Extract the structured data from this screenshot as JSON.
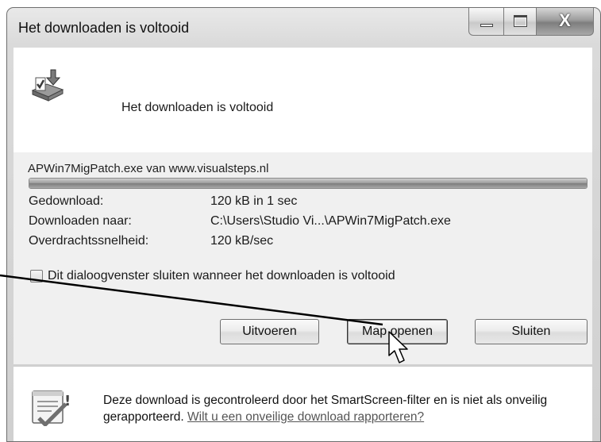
{
  "window": {
    "title": "Het downloaden is voltooid",
    "close_glyph": "X"
  },
  "header": {
    "title": "Het downloaden is voltooid"
  },
  "download": {
    "file_line": "APWin7MigPatch.exe van www.visualsteps.nl",
    "progress": 1.0,
    "rows": [
      {
        "label": "Gedownload:",
        "value": "120 kB in 1 sec"
      },
      {
        "label": "Downloaden naar:",
        "value": "C:\\Users\\Studio Vi...\\APWin7MigPatch.exe"
      },
      {
        "label": "Overdrachtssnelheid:",
        "value": "120 kB/sec"
      }
    ]
  },
  "options": {
    "close_checkbox_label": "Dit dialoogvenster sluiten wanneer het downloaden is voltooid",
    "close_checkbox_checked": false
  },
  "buttons": {
    "run": "Uitvoeren",
    "open_folder": "Map openen",
    "close": "Sluiten"
  },
  "footer": {
    "text": "Deze download is gecontroleerd door het SmartScreen-filter en is niet als onveilig gerapporteerd.",
    "link": "Wilt u een onveilige download rapporteren?"
  },
  "icons": {
    "download": "download-complete-icon",
    "footer": "smartscreen-shield-icon",
    "cursor": "mouse-pointer-icon"
  }
}
